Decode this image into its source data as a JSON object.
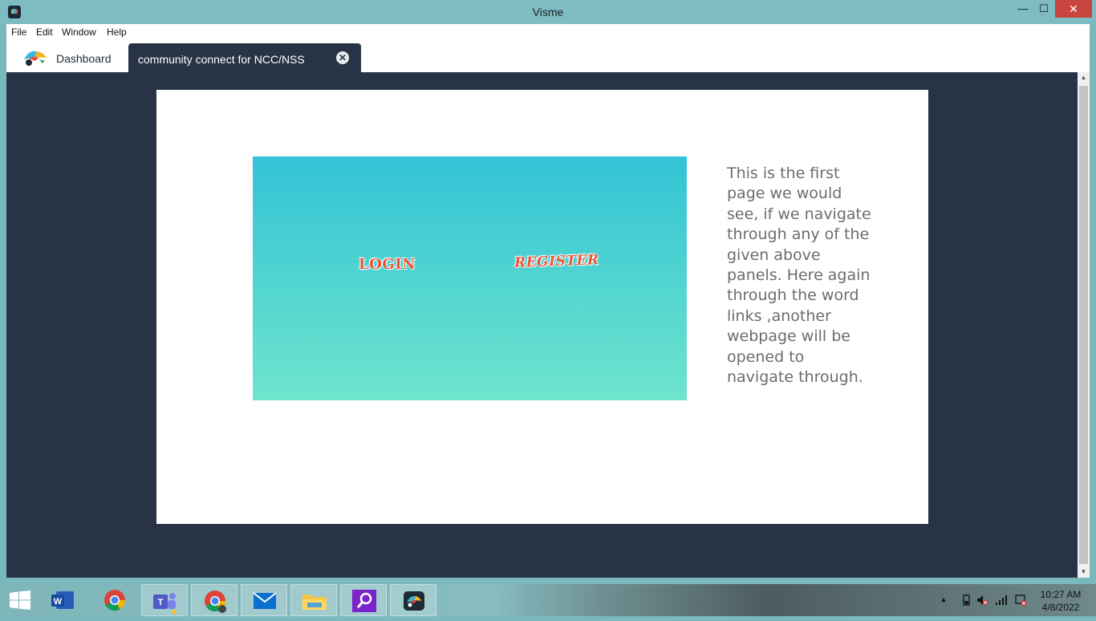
{
  "window": {
    "title": "Visme",
    "min_glyph": "—",
    "max_glyph": "☐",
    "close_glyph": "✕"
  },
  "menu": {
    "items": [
      "File",
      "Edit",
      "Window",
      "Help"
    ]
  },
  "tabs": {
    "dashboard": "Dashboard",
    "active": "community connect for NCC/NSS",
    "close_glyph": "✕"
  },
  "slide": {
    "login": "LOGIN",
    "register": "REGISTER",
    "description": "This is the first page we would see, if we navigate through any of the given above panels. Here again through the word links ,another webpage will be opened to navigate through."
  },
  "scrollbar": {
    "up_glyph": "▲",
    "down_glyph": "▼"
  },
  "taskbar": {
    "apps": [
      "word-icon",
      "chrome-icon",
      "teams-icon",
      "chrome-profile-icon",
      "mail-icon",
      "file-explorer-icon",
      "search-app-icon",
      "visme-icon"
    ],
    "tray_icons": [
      "show-hidden-icons",
      "battery-icon",
      "volume-muted-icon",
      "wifi-icon",
      "notification-icon"
    ],
    "time": "10:27 AM",
    "date": "4/8/2022",
    "tray_up_glyph": "▲"
  }
}
